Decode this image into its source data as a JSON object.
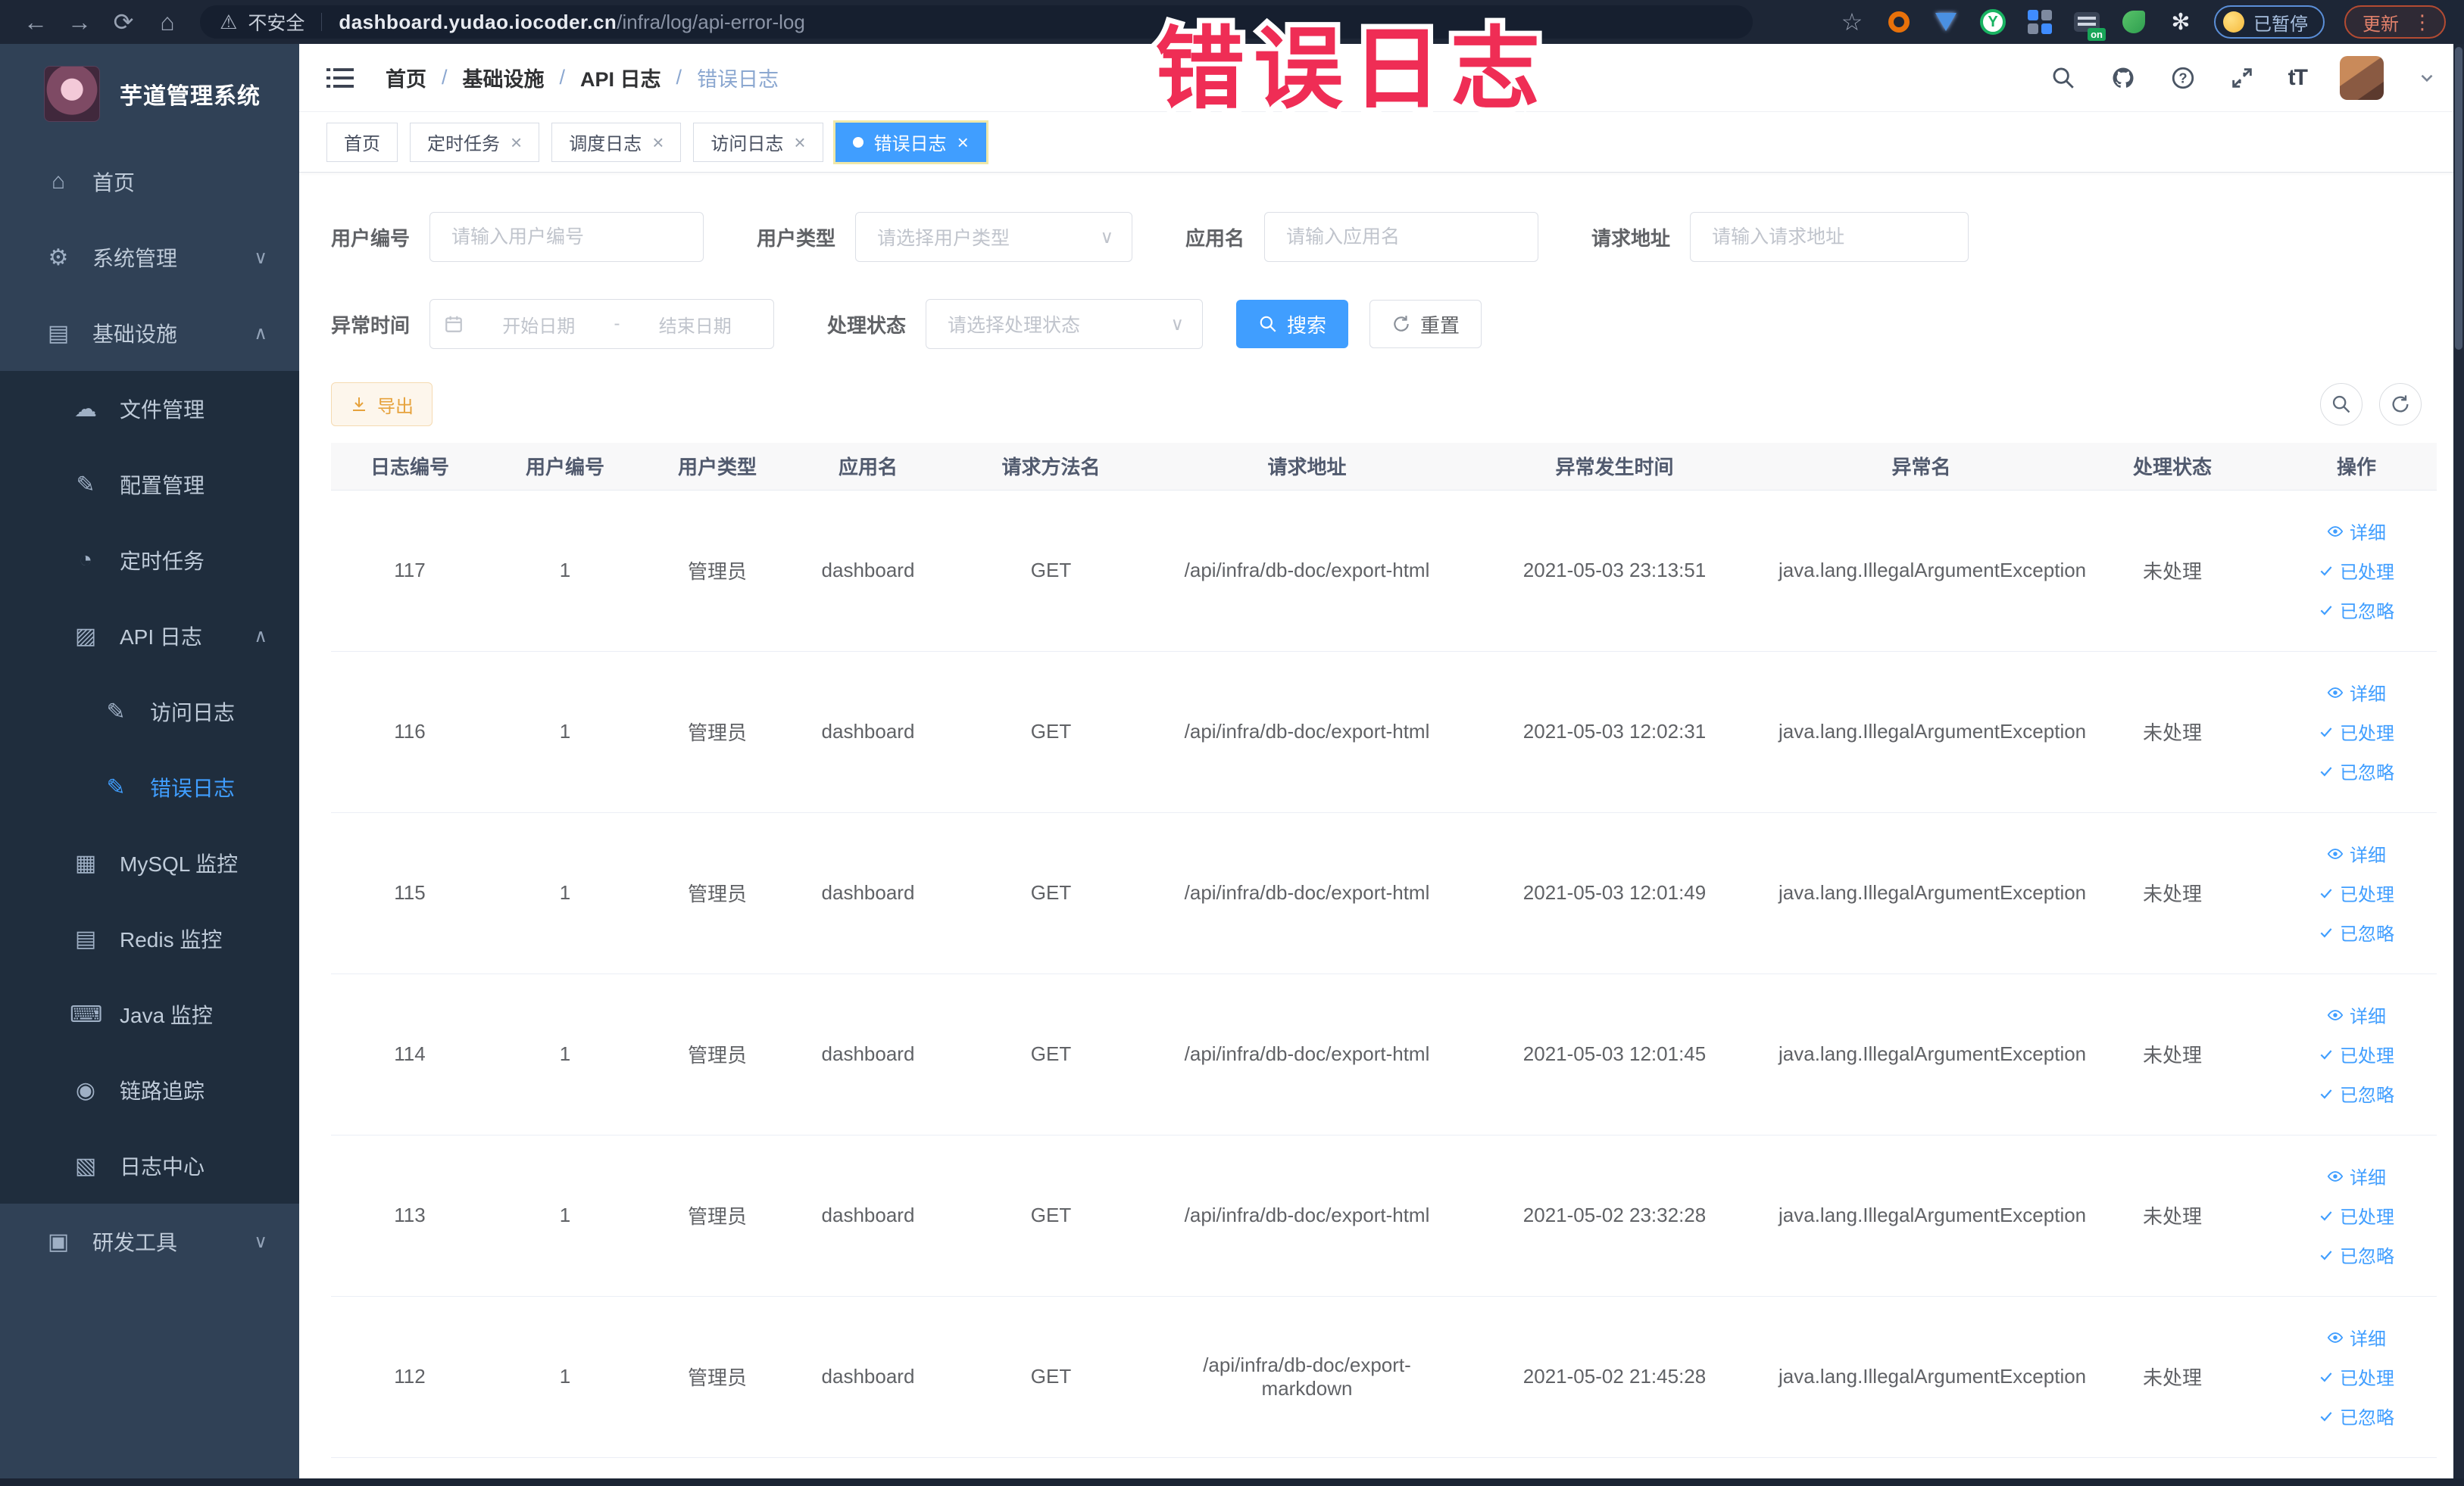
{
  "colors": {
    "accent": "#409eff",
    "warning": "#e6a23c",
    "annotation_red": "#ef2d55",
    "sidebar_bg": "#304156",
    "submenu_bg": "#1f2d3d"
  },
  "icons": {
    "back": "←",
    "forward": "→",
    "reload": "⟳",
    "home": "⌂",
    "warning": "⚠",
    "star": "☆",
    "puzzle": "✻",
    "kebab": "⋮",
    "caret_down": "∨",
    "chevron_down": "∨",
    "chevron_up": "∧"
  },
  "annotation": {
    "text": "错误日志"
  },
  "browser": {
    "security_label": "不安全",
    "url_domain": "dashboard.yudao.iocoder.cn",
    "url_path": "/infra/log/api-error-log",
    "paused_label": "已暂停",
    "update_label": "更新"
  },
  "sidebar": {
    "title": "芋道管理系统",
    "items": [
      {
        "label": "首页",
        "icon": "⌂"
      },
      {
        "label": "系统管理",
        "icon": "⚙"
      },
      {
        "label": "基础设施",
        "icon": "▤"
      },
      {
        "label": "文件管理",
        "icon": "☁"
      },
      {
        "label": "配置管理",
        "icon": "✎"
      },
      {
        "label": "定时任务",
        "icon": "◔"
      },
      {
        "label": "API 日志",
        "icon": "▨"
      },
      {
        "label": "访问日志",
        "icon": "✎"
      },
      {
        "label": "错误日志",
        "icon": "✎"
      },
      {
        "label": "MySQL 监控",
        "icon": "▦"
      },
      {
        "label": "Redis 监控",
        "icon": "▤"
      },
      {
        "label": "Java 监控",
        "icon": "⌨"
      },
      {
        "label": "链路追踪",
        "icon": "◉"
      },
      {
        "label": "日志中心",
        "icon": "▧"
      },
      {
        "label": "研发工具",
        "icon": "▣"
      }
    ]
  },
  "header": {
    "breadcrumb": [
      "首页",
      "基础设施",
      "API 日志",
      "错误日志"
    ],
    "font_icon_label": "tT"
  },
  "tabs": [
    {
      "label": "首页"
    },
    {
      "label": "定时任务"
    },
    {
      "label": "调度日志"
    },
    {
      "label": "访问日志"
    },
    {
      "label": "错误日志"
    }
  ],
  "filters": {
    "user_id_label": "用户编号",
    "user_id_placeholder": "请输入用户编号",
    "user_type_label": "用户类型",
    "user_type_placeholder": "请选择用户类型",
    "app_name_label": "应用名",
    "app_name_placeholder": "请输入应用名",
    "request_url_label": "请求地址",
    "request_url_placeholder": "请输入请求地址",
    "exception_time_label": "异常时间",
    "date_start_placeholder": "开始日期",
    "date_separator": "-",
    "date_end_placeholder": "结束日期",
    "process_status_label": "处理状态",
    "process_status_placeholder": "请选择处理状态",
    "search_label": "搜索",
    "reset_label": "重置"
  },
  "toolbar": {
    "export_label": "导出"
  },
  "table": {
    "columns": [
      "日志编号",
      "用户编号",
      "用户类型",
      "应用名",
      "请求方法名",
      "请求地址",
      "异常发生时间",
      "异常名",
      "处理状态",
      "操作"
    ],
    "actions": [
      {
        "label": "详细"
      },
      {
        "label": "已处理"
      },
      {
        "label": "已忽略"
      }
    ],
    "rows": [
      [
        "117",
        "1",
        "管理员",
        "dashboard",
        "GET",
        "/api/infra/db-doc/export-html",
        "2021-05-03 23:13:51",
        "java.lang.IllegalArgumentException",
        "未处理"
      ],
      [
        "116",
        "1",
        "管理员",
        "dashboard",
        "GET",
        "/api/infra/db-doc/export-html",
        "2021-05-03 12:02:31",
        "java.lang.IllegalArgumentException",
        "未处理"
      ],
      [
        "115",
        "1",
        "管理员",
        "dashboard",
        "GET",
        "/api/infra/db-doc/export-html",
        "2021-05-03 12:01:49",
        "java.lang.IllegalArgumentException",
        "未处理"
      ],
      [
        "114",
        "1",
        "管理员",
        "dashboard",
        "GET",
        "/api/infra/db-doc/export-html",
        "2021-05-03 12:01:45",
        "java.lang.IllegalArgumentException",
        "未处理"
      ],
      [
        "113",
        "1",
        "管理员",
        "dashboard",
        "GET",
        "/api/infra/db-doc/export-html",
        "2021-05-02 23:32:28",
        "java.lang.IllegalArgumentException",
        "未处理"
      ],
      [
        "112",
        "1",
        "管理员",
        "dashboard",
        "GET",
        "/api/infra/db-doc/export-markdown",
        "2021-05-02 21:45:28",
        "java.lang.IllegalArgumentException",
        "未处理"
      ]
    ]
  }
}
